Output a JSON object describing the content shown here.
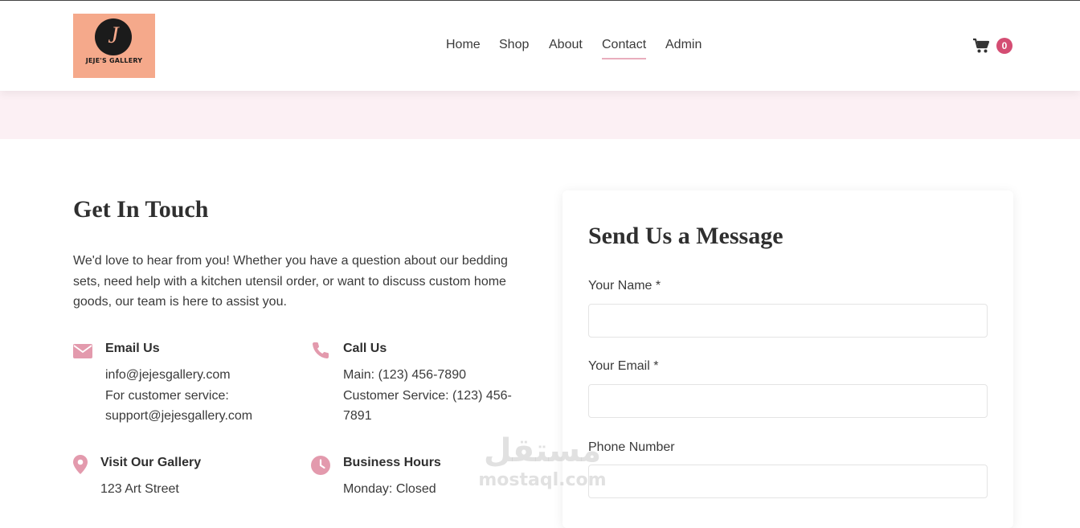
{
  "header": {
    "logo_text": "JEJE'S GALLERY",
    "logo_monogram": "J",
    "nav": [
      {
        "label": "Home"
      },
      {
        "label": "Shop"
      },
      {
        "label": "About"
      },
      {
        "label": "Contact",
        "active": true
      },
      {
        "label": "Admin"
      }
    ],
    "cart_count": "0"
  },
  "contact": {
    "title": "Get In Touch",
    "intro": "We'd love to hear from you! Whether you have a question about our bedding sets, need help with a kitchen utensil order, or want to discuss custom home goods, our team is here to assist you.",
    "email": {
      "icon": "envelope-icon",
      "title": "Email Us",
      "line1": "info@jejesgallery.com",
      "line2": "For customer service:",
      "line3": "support@jejesgallery.com"
    },
    "phone": {
      "icon": "phone-icon",
      "title": "Call Us",
      "line1": "Main: (123) 456-7890",
      "line2": "Customer Service: (123) 456-",
      "line3": "7891"
    },
    "visit": {
      "icon": "map-pin-icon",
      "title": "Visit Our Gallery",
      "line1": "123 Art Street"
    },
    "hours": {
      "icon": "clock-icon",
      "title": "Business Hours",
      "line1": "Monday: Closed"
    }
  },
  "form": {
    "title": "Send Us a Message",
    "name_label": "Your Name *",
    "name_value": "",
    "email_label": "Your Email *",
    "email_value": "",
    "phone_label": "Phone Number",
    "phone_value": ""
  },
  "watermark": {
    "arabic": "مستقل",
    "latin": "mostaql.com"
  },
  "colors": {
    "accent": "#d44d73",
    "icon_pink": "#e39aad",
    "band": "#fcf0f4",
    "logo_bg": "#f5a98b"
  }
}
